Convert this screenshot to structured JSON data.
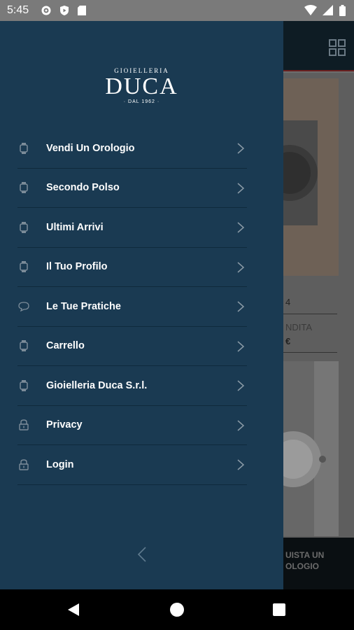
{
  "status_bar": {
    "time": "5:45"
  },
  "logo": {
    "line1": "GIOIELLERIA",
    "line2": "DUCA",
    "line3": "· DAL 1962 ·"
  },
  "menu": [
    {
      "label": "Vendi Un Orologio",
      "icon": "watch-icon"
    },
    {
      "label": "Secondo Polso",
      "icon": "watch-icon"
    },
    {
      "label": "Ultimi Arrivi",
      "icon": "watch-icon"
    },
    {
      "label": "Il Tuo Profilo",
      "icon": "watch-icon"
    },
    {
      "label": "Le Tue Pratiche",
      "icon": "chat-bubble-icon"
    },
    {
      "label": "Carrello",
      "icon": "watch-icon"
    },
    {
      "label": "Gioielleria Duca S.r.l.",
      "icon": "watch-icon"
    },
    {
      "label": "Privacy",
      "icon": "lock-icon"
    },
    {
      "label": "Login",
      "icon": "lock-icon"
    }
  ],
  "background": {
    "card_text_1": "4",
    "card_text_2": "NDITA",
    "card_text_3": "€",
    "cta_line1": "UISTA UN",
    "cta_line2": "OLOGIO"
  },
  "colors": {
    "drawer": "#1a3a52",
    "appbar": "#0e1c24",
    "accent": "#6a1f1f"
  }
}
